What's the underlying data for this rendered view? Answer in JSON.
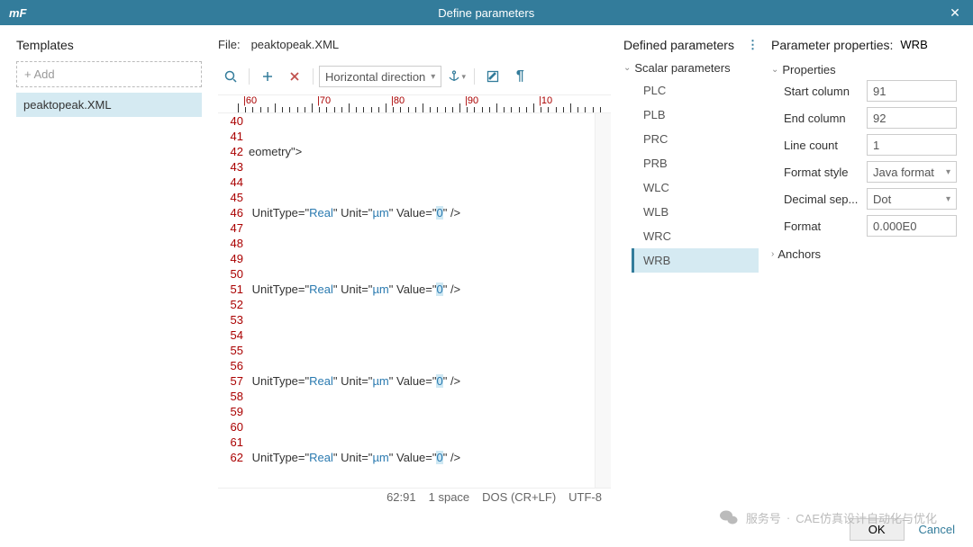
{
  "titlebar": {
    "logo": "mF",
    "title": "Define parameters"
  },
  "templates": {
    "heading": "Templates",
    "add_label": "+ Add",
    "items": [
      "peaktopeak.XML"
    ]
  },
  "center": {
    "file_label": "File:",
    "file_name": "peaktopeak.XML",
    "direction_label": "Horizontal direction",
    "ruler_labels": [
      "60",
      "70",
      "80",
      "90",
      "10"
    ],
    "lines": [
      {
        "n": 40,
        "t": ""
      },
      {
        "n": 41,
        "t": ""
      },
      {
        "n": 42,
        "t": "eometry\">"
      },
      {
        "n": 43,
        "t": ""
      },
      {
        "n": 44,
        "t": ""
      },
      {
        "n": 45,
        "t": ""
      },
      {
        "n": 46,
        "t": " UnitType=\"Real\" Unit=\"µm\" Value=\"0\" />",
        "hl": true
      },
      {
        "n": 47,
        "t": ""
      },
      {
        "n": 48,
        "t": ""
      },
      {
        "n": 49,
        "t": ""
      },
      {
        "n": 50,
        "t": ""
      },
      {
        "n": 51,
        "t": " UnitType=\"Real\" Unit=\"µm\" Value=\"0\" />",
        "hl": true
      },
      {
        "n": 52,
        "t": ""
      },
      {
        "n": 53,
        "t": ""
      },
      {
        "n": 54,
        "t": ""
      },
      {
        "n": 55,
        "t": ""
      },
      {
        "n": 56,
        "t": ""
      },
      {
        "n": 57,
        "t": " UnitType=\"Real\" Unit=\"µm\" Value=\"0\" />",
        "hl": true
      },
      {
        "n": 58,
        "t": ""
      },
      {
        "n": 59,
        "t": ""
      },
      {
        "n": 60,
        "t": ""
      },
      {
        "n": 61,
        "t": ""
      },
      {
        "n": 62,
        "t": " UnitType=\"Real\" Unit=\"µm\" Value=\"0\" />",
        "hl": true
      }
    ],
    "status": {
      "pos": "62:91",
      "indent": "1 space",
      "eol": "DOS (CR+LF)",
      "enc": "UTF-8"
    }
  },
  "defined": {
    "heading": "Defined parameters",
    "group": "Scalar parameters",
    "params": [
      "PLC",
      "PLB",
      "PRC",
      "PRB",
      "WLC",
      "WLB",
      "WRC",
      "WRB"
    ],
    "selected": "WRB"
  },
  "props": {
    "heading": "Parameter properties:",
    "name": "WRB",
    "section_properties": "Properties",
    "section_anchors": "Anchors",
    "rows": {
      "start_col": {
        "label": "Start column",
        "value": "91"
      },
      "end_col": {
        "label": "End column",
        "value": "92"
      },
      "line_count": {
        "label": "Line count",
        "value": "1"
      },
      "fmt_style": {
        "label": "Format style",
        "value": "Java format"
      },
      "dec_sep": {
        "label": "Decimal sep...",
        "value": "Dot"
      },
      "format": {
        "label": "Format",
        "value": "0.000E0"
      }
    }
  },
  "footer": {
    "ok": "OK",
    "cancel": "Cancel"
  },
  "watermark": {
    "svc": "服务号",
    "dot": "·",
    "text": "CAE仿真设计自动化与优化"
  }
}
